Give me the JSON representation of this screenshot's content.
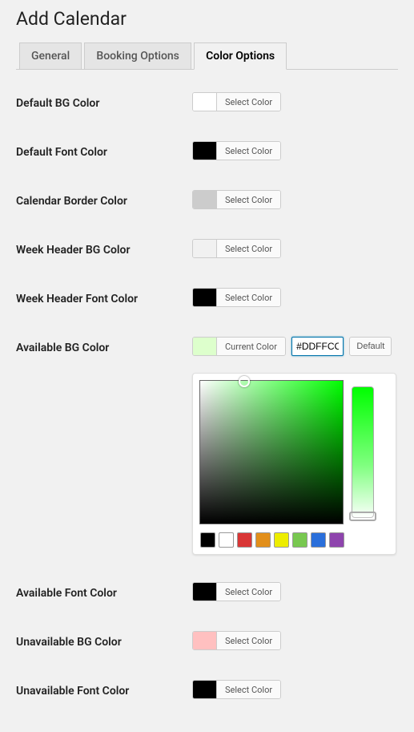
{
  "page_title": "Add Calendar",
  "tabs": [
    {
      "label": "General",
      "active": false
    },
    {
      "label": "Booking Options",
      "active": false
    },
    {
      "label": "Color Options",
      "active": true
    }
  ],
  "select_color_label": "Select Color",
  "current_color_label": "Current Color",
  "default_label": "Default",
  "fields": {
    "default_bg": {
      "label": "Default BG Color",
      "swatch": "#ffffff"
    },
    "default_font": {
      "label": "Default Font Color",
      "swatch": "#000000"
    },
    "cal_border": {
      "label": "Calendar Border Color",
      "swatch": "#cccccc"
    },
    "week_hdr_bg": {
      "label": "Week Header BG Color",
      "swatch": "#f1f1f1"
    },
    "week_hdr_font": {
      "label": "Week Header Font Color",
      "swatch": "#000000"
    },
    "avail_bg": {
      "label": "Available BG Color",
      "swatch": "#DDFFCC",
      "hex": "#DDFFCC"
    },
    "avail_font": {
      "label": "Available Font Color",
      "swatch": "#000000"
    },
    "unavail_bg": {
      "label": "Unavailable BG Color",
      "swatch": "#ffc0c0"
    },
    "unavail_font": {
      "label": "Unavailable Font Color",
      "swatch": "#000000"
    }
  },
  "palette": [
    "#000000",
    "#ffffff",
    "#d93636",
    "#e28f1b",
    "#eded00",
    "#78c850",
    "#2a6fdb",
    "#8e44ad"
  ]
}
